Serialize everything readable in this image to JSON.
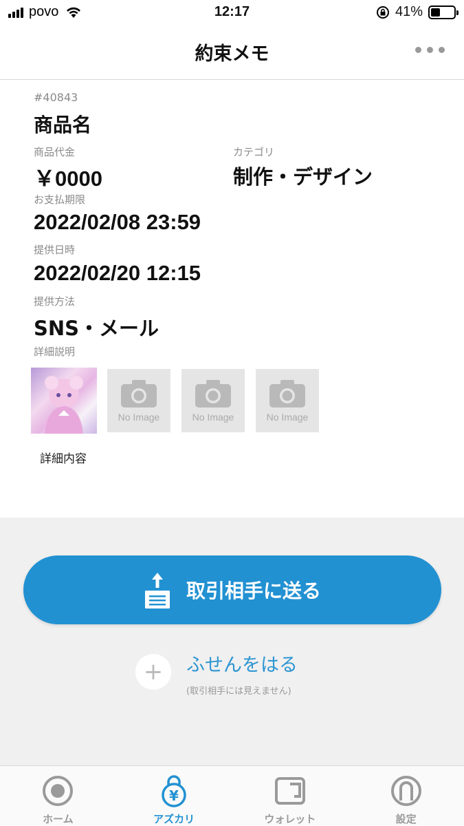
{
  "status_bar": {
    "carrier": "povo",
    "time": "12:17",
    "battery_percent": "41%",
    "battery_level": 0.41
  },
  "header": {
    "title": "約束メモ"
  },
  "memo": {
    "id": "#40843",
    "product_name": "商品名",
    "price_label": "商品代金",
    "price_value": "￥0000",
    "category_label": "カテゴリ",
    "category_value": "制作・デザイン",
    "payment_deadline_label": "お支払期限",
    "payment_deadline_value": "2022/02/08 23:59",
    "delivery_datetime_label": "提供日時",
    "delivery_datetime_value": "2022/02/20 12:15",
    "delivery_method_label": "提供方法",
    "delivery_method_value": "SNS・メール",
    "detail_label": "詳細説明",
    "no_image_text": "No Image",
    "detail_text": "詳細内容"
  },
  "actions": {
    "send_label": "取引相手に送る",
    "sticky_label": "ふせんをはる",
    "sticky_sub": "(取引相手には見えません)"
  },
  "tabs": [
    {
      "label": "ホーム",
      "icon": "home-icon",
      "active": false
    },
    {
      "label": "アズカリ",
      "icon": "azukari-icon",
      "active": true
    },
    {
      "label": "ウォレット",
      "icon": "wallet-icon",
      "active": false
    },
    {
      "label": "設定",
      "icon": "settings-icon",
      "active": false
    }
  ],
  "colors": {
    "accent": "#2291d2",
    "background_gray": "#f0f0f0",
    "label_gray": "#8a8a8a"
  }
}
